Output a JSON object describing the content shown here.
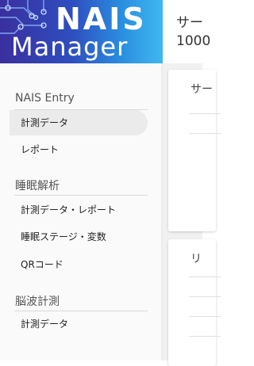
{
  "header": {
    "logo_word1": "NAIS",
    "logo_word2": "Manager",
    "right_line1": "サー",
    "right_line2": "1000"
  },
  "sidebar": {
    "sections": [
      {
        "title": "NAIS Entry",
        "items": [
          "計測データ",
          "レポート"
        ]
      },
      {
        "title": "睡眠解析",
        "items": [
          "計測データ・レポート",
          "睡眠ステージ・変数",
          "QRコード"
        ]
      },
      {
        "title": "脳波計測",
        "items": [
          "計測データ"
        ]
      }
    ],
    "active_item": "計測データ"
  },
  "main": {
    "card1_title": "サー",
    "card2_title": "リ"
  }
}
